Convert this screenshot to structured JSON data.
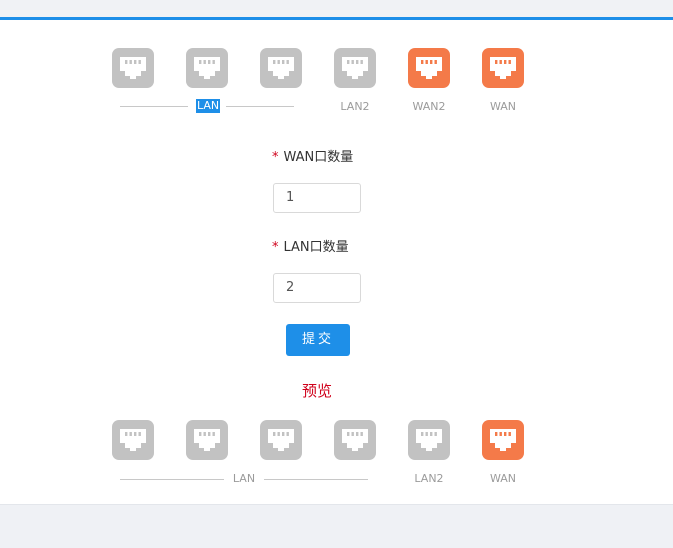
{
  "top_ports": [
    {
      "color": "gray"
    },
    {
      "color": "gray"
    },
    {
      "color": "gray"
    },
    {
      "color": "gray",
      "label": "LAN2"
    },
    {
      "color": "orange",
      "label": "WAN2"
    },
    {
      "color": "orange",
      "label": "WAN"
    }
  ],
  "top_group_label": "LAN",
  "top_labels": {
    "lan2": "LAN2",
    "wan2": "WAN2",
    "wan": "WAN"
  },
  "form": {
    "wan_label": "WAN口数量",
    "wan_value": "1",
    "lan_label": "LAN口数量",
    "lan_value": "2",
    "required_mark": "*",
    "submit_label": "提交"
  },
  "preview_title": "预览",
  "bottom_group_label": "LAN",
  "bottom_labels": {
    "lan2": "LAN2",
    "wan": "WAN"
  },
  "colors": {
    "accent": "#1e8fe8",
    "port_inactive": "#c2c2c2",
    "port_wan": "#f47a49",
    "required": "#d0011b"
  },
  "icons": {
    "port": "ethernet-port-icon"
  }
}
